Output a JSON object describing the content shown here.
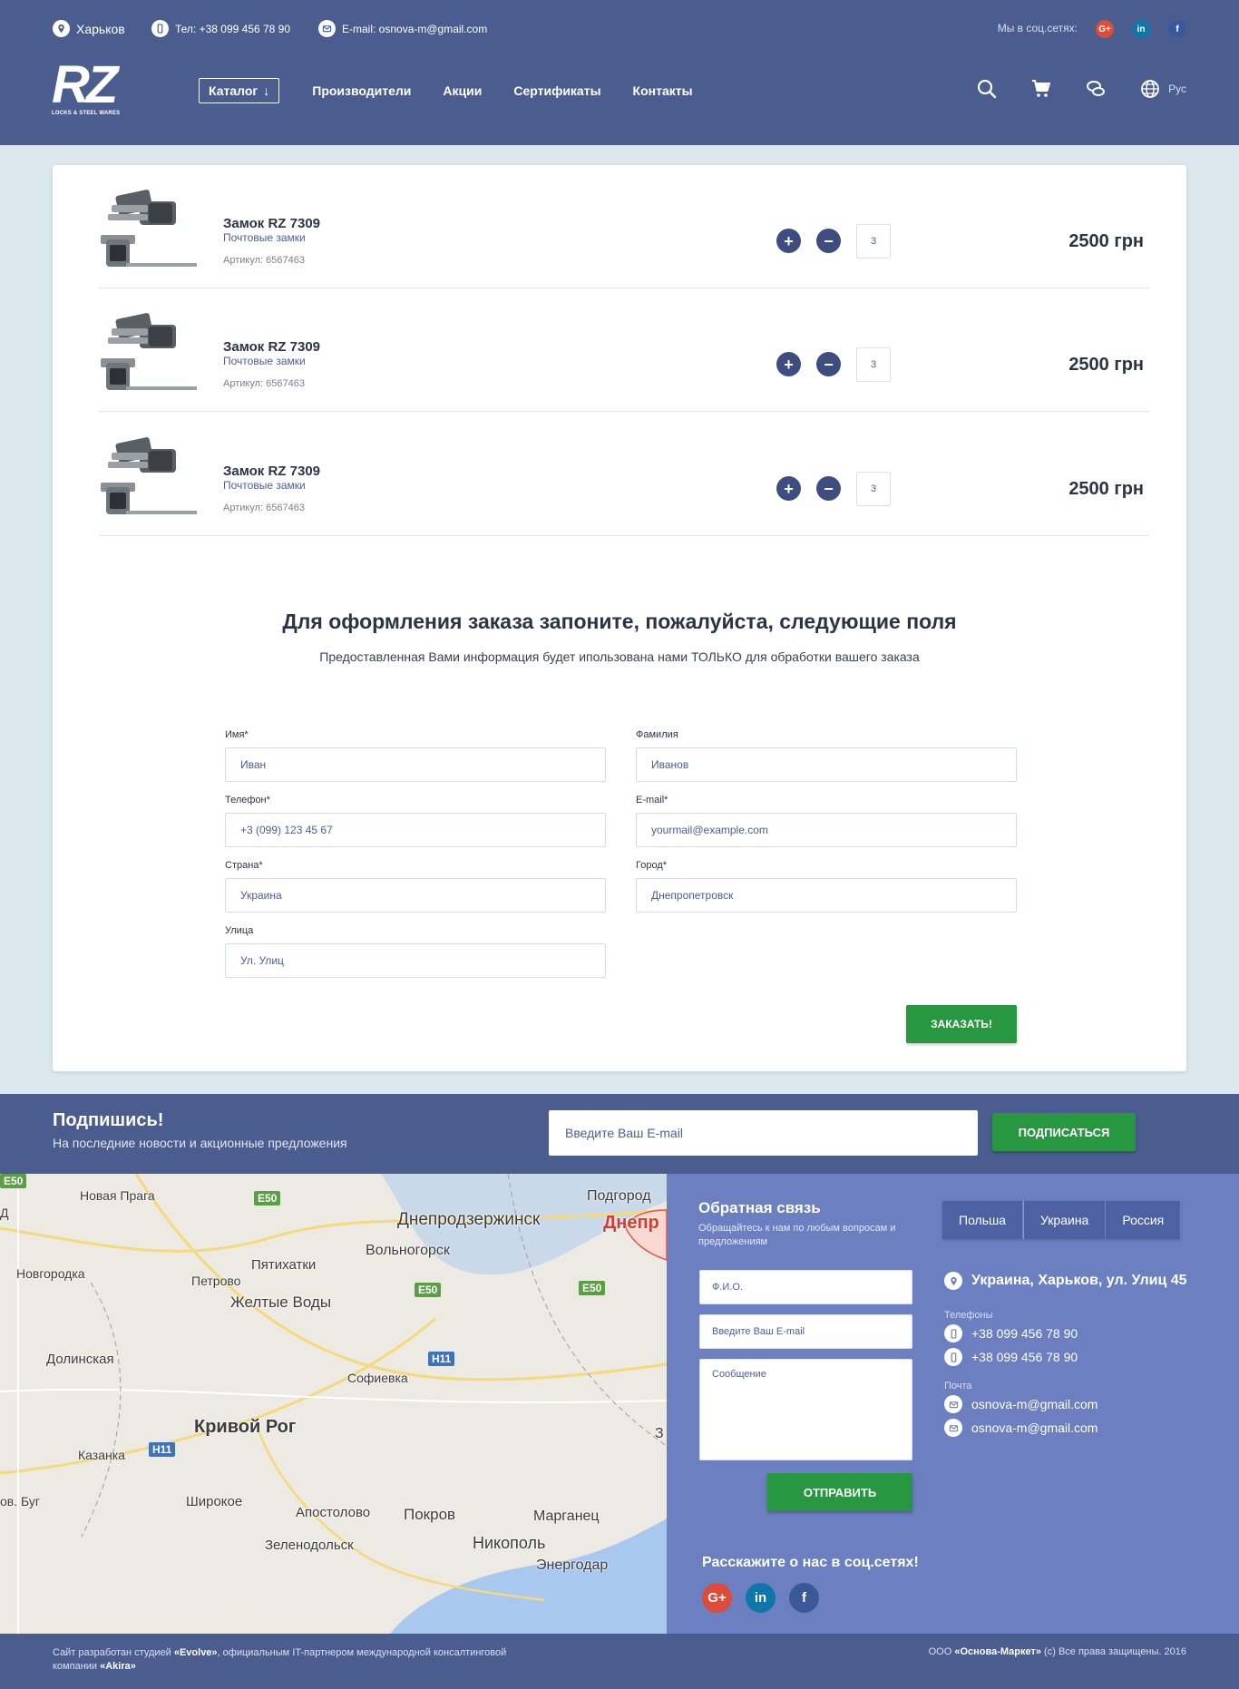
{
  "topbar": {
    "city": "Харьков",
    "phone": "Тел: +38 099 456 78 90",
    "email": "E-mail: osnova-m@gmail.com",
    "social_label": "Мы в соц.сетях:",
    "social": [
      {
        "label": "G+",
        "icon": "google-plus-icon",
        "color": "#dd4b39"
      },
      {
        "label": "in",
        "icon": "linkedin-icon",
        "color": "#0e76a8"
      },
      {
        "label": "f",
        "icon": "facebook-icon",
        "color": "#3b5998"
      }
    ]
  },
  "logo": {
    "text": "RZ",
    "sub": "LOCKS & STEEL WARES"
  },
  "nav": {
    "catalog": "Каталог",
    "links": [
      "Производители",
      "Акции",
      "Сертификаты",
      "Контакты"
    ],
    "lang": "Рус"
  },
  "cart": {
    "items": [
      {
        "title": "Замок RZ 7309",
        "category": "Почтовые замки",
        "sku": "Артикул: 6567463",
        "qty": "3",
        "price": "2500 грн"
      },
      {
        "title": "Замок RZ 7309",
        "category": "Почтовые замки",
        "sku": "Артикул: 6567463",
        "qty": "3",
        "price": "2500 грн"
      },
      {
        "title": "Замок RZ 7309",
        "category": "Почтовые замки",
        "sku": "Артикул: 6567463",
        "qty": "3",
        "price": "2500 грн"
      }
    ],
    "plus": "+",
    "minus": "−"
  },
  "order_form": {
    "title": "Для оформления заказа запоните, пожалуйста, следующие поля",
    "subtitle": "Предоставленная Вами информация будет ипользована нами ТОЛЬКО для обработки вашего заказа",
    "fields": {
      "first_name": {
        "label": "Имя*",
        "placeholder": "Иван"
      },
      "last_name": {
        "label": "Фамилия",
        "placeholder": "Иванов"
      },
      "phone": {
        "label": "Телефон*",
        "placeholder": "+3 (099) 123 45 67"
      },
      "email": {
        "label": "E-mail*",
        "placeholder": "yourmail@example.com"
      },
      "country": {
        "label": "Страна*",
        "placeholder": "Украина"
      },
      "city": {
        "label": "Город*",
        "placeholder": "Днепропетровск"
      },
      "street": {
        "label": "Улица",
        "placeholder": "Ул. Улиц"
      }
    },
    "submit": "ЗАКАЗАТЬ!"
  },
  "subscribe": {
    "title": "Подпишись!",
    "text": "На последние новости и акционные предложения",
    "placeholder": "Введите Ваш E-mail",
    "button": "ПОДПИСАТЬСЯ"
  },
  "map": {
    "labels": [
      "Новая Прага",
      "Подгород",
      "Днепродзержинск",
      "Днепр",
      "Вольногорск",
      "Пятихатки",
      "Новгородка",
      "Петрово",
      "Желтые Воды",
      "Долинская",
      "Софиевка",
      "Кривой Рог",
      "Казанка",
      "Широкое",
      "Апостолово",
      "Покров",
      "Марганец",
      "Никополь",
      "Зеленодольск",
      "Энергодар",
      "ов. Буг",
      "Д",
      "З"
    ],
    "roads": [
      "E50",
      "E50",
      "E50",
      "E50",
      "H11",
      "H11"
    ]
  },
  "contact": {
    "title": "Обратная связь",
    "subtitle": "Обращайтесь к нам по любым вопросам и предложениям",
    "name_placeholder": "Ф.И.О.",
    "email_placeholder": "Введите Ваш E-mail",
    "message_placeholder": "Сообщение",
    "send": "ОТПРАВИТЬ",
    "share_title": "Расскажите о нас в соц.сетях!",
    "tabs": [
      "Польша",
      "Украина",
      "Россия"
    ],
    "active_tab": "Украина",
    "address": "Украина, Харьков, ул. Улиц 45",
    "phones_label": "Телефоны",
    "phones": [
      "+38 099 456 78 90",
      "+38 099 456 78 90"
    ],
    "mail_label": "Почта",
    "emails": [
      "osnova-m@gmail.com",
      "osnova-m@gmail.com"
    ]
  },
  "footer": {
    "left_1": "Сайт разработан студией ",
    "left_studio": "«Evolve»",
    "left_2": ", официальным IT-партнером международной консалтинговой компании ",
    "left_company": "«Akira»",
    "right_1": "ООО ",
    "right_company": "«Основа-Маркет»",
    "right_2": " (с) Все права защищены. 2016"
  },
  "colors": {
    "header": "#4b5d8f",
    "accent_green": "#27983f",
    "contact_bg": "#6b7fc1",
    "page_bg": "#dbe8ee"
  }
}
